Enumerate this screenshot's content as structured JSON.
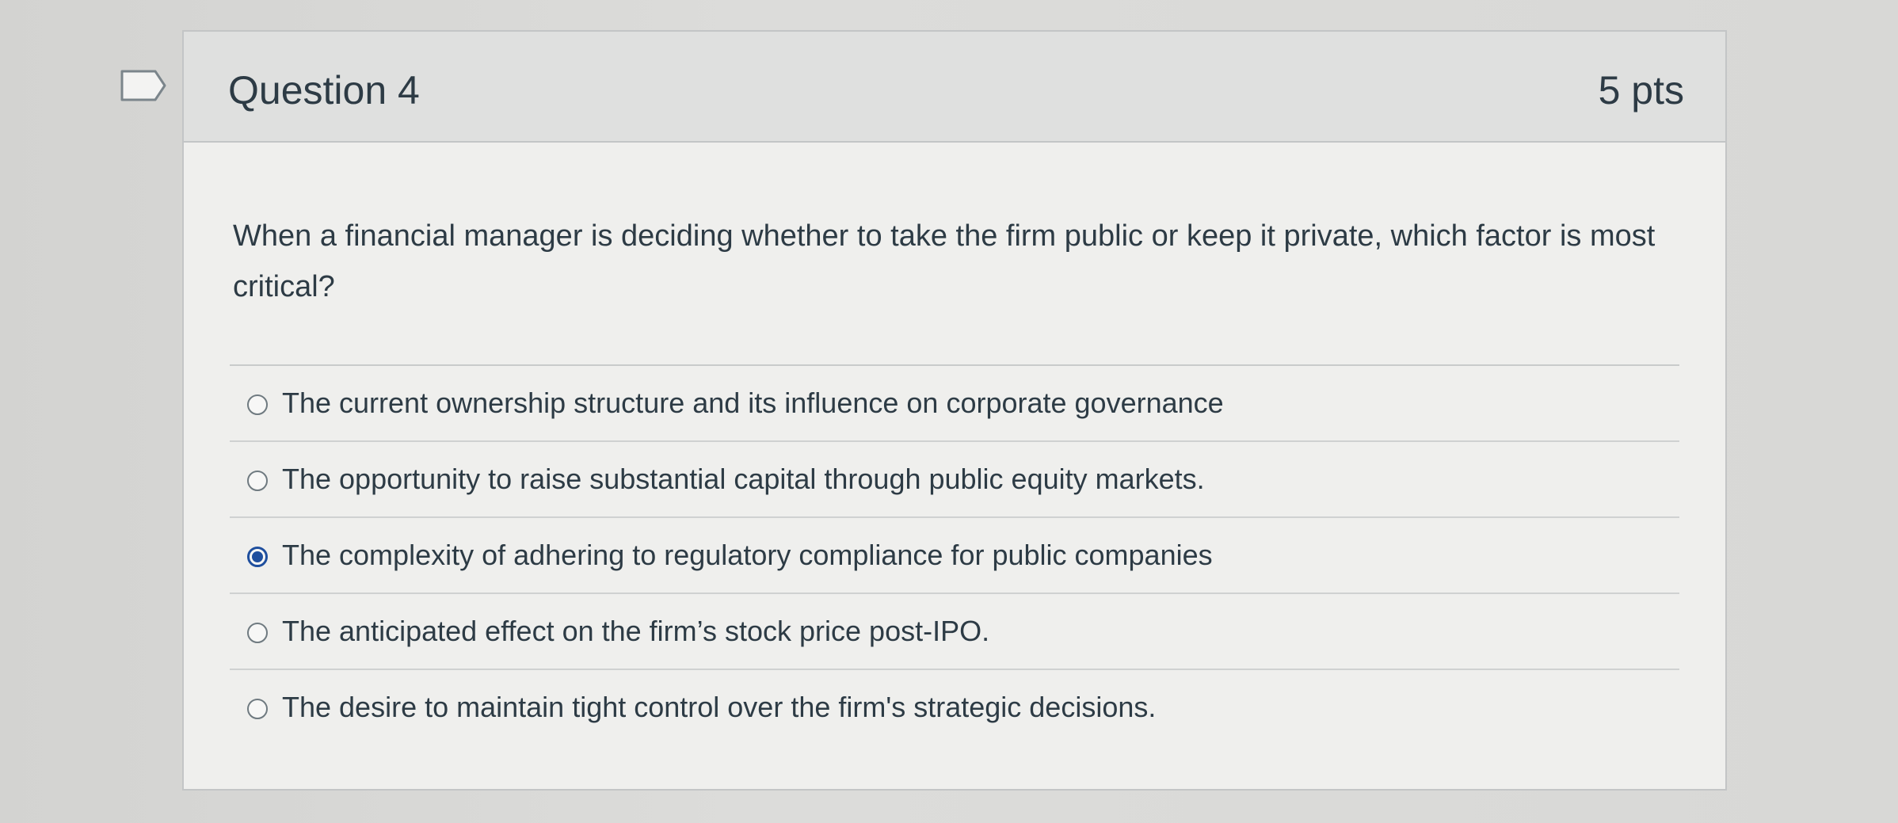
{
  "question": {
    "title": "Question 4",
    "points": "5 pts",
    "flag_icon": "flag-outline-icon",
    "text": "When a financial manager is deciding whether to take the firm public or keep it private, which factor is most critical?",
    "answers": [
      {
        "label": "The current ownership structure and its influence on corporate governance",
        "selected": false
      },
      {
        "label": "The opportunity to raise substantial capital through public equity markets.",
        "selected": false
      },
      {
        "label": "The complexity of adhering to regulatory compliance for public companies",
        "selected": true
      },
      {
        "label": "The anticipated effect on the firm’s stock price post-IPO.",
        "selected": false
      },
      {
        "label": "The desire to maintain tight control over the firm's strategic decisions.",
        "selected": false
      }
    ]
  },
  "colors": {
    "selected_radio": "#1f4f9e",
    "header_bg": "#dfe0df",
    "text": "#2d3b45"
  }
}
